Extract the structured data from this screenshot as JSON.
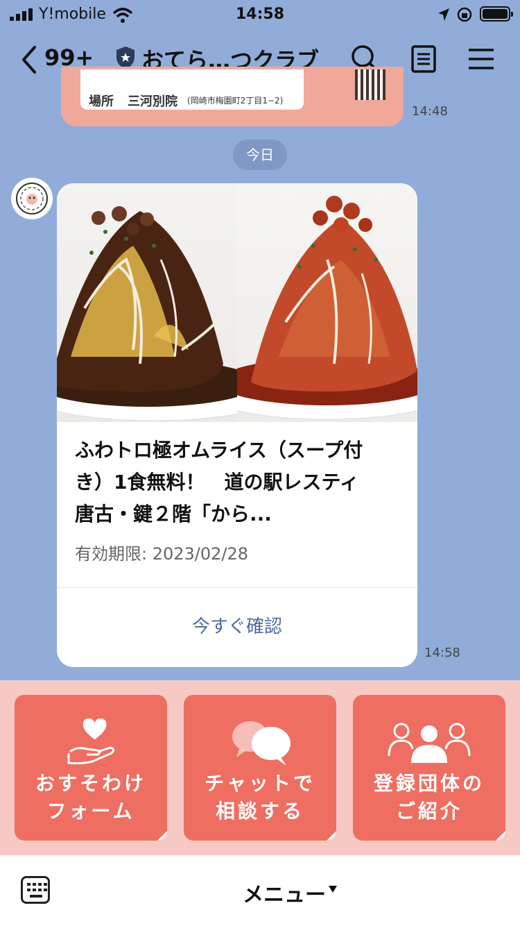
{
  "status_bar": {
    "carrier": "Y!mobile",
    "time": "14:58"
  },
  "header": {
    "unread_count": "99+",
    "title": "おてら…つクラブ"
  },
  "previous_message": {
    "place_label": "場所",
    "place": "三河別院",
    "address": "(岡崎市梅園町2丁目1−2)",
    "time": "14:48"
  },
  "date_separator": "今日",
  "message": {
    "title_lines": [
      "ふわトロ極オムライス（スープ付",
      "き）1食無料！　道の駅レスティ",
      "唐古・鍵２階「から..."
    ],
    "expiry": "有効期限: 2023/02/28",
    "confirm_label": "今すぐ確認",
    "time": "14:58"
  },
  "rich_menu": {
    "tiles": [
      {
        "line1": "おすそわけ",
        "line2": "フォーム",
        "icon": "heart-hand-icon"
      },
      {
        "line1": "チャットで",
        "line2": "相談する",
        "icon": "chat-bubbles-icon"
      },
      {
        "line1": "登録団体の",
        "line2": "ご紹介",
        "icon": "people-group-icon"
      }
    ],
    "color": "#ee6e62",
    "background": "#f7c9c5"
  },
  "bottom_bar": {
    "menu_label": "メニュー"
  }
}
